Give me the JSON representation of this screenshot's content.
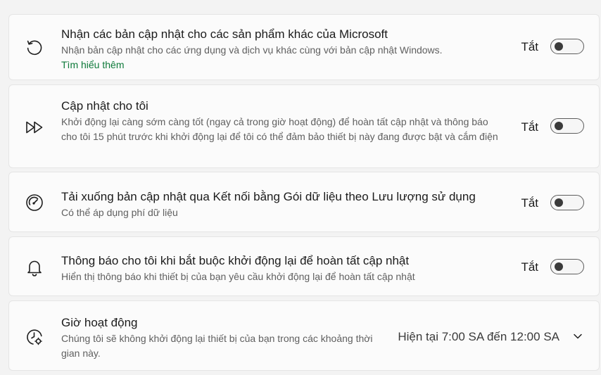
{
  "settings": [
    {
      "title": "Nhận các bản cập nhật cho các sản phẩm khác của Microsoft",
      "description": "Nhận bản cập nhật cho các ứng dụng và dịch vụ khác cùng với bản cập nhật Windows.",
      "link": "Tìm hiểu thêm",
      "state": "Tắt",
      "toggle_on": false,
      "icon": "history-icon"
    },
    {
      "title": "Cập nhật cho tôi",
      "description": "Khởi động lại càng sớm càng tốt (ngay cả trong giờ hoạt động) để hoàn tất cập nhật và thông báo cho tôi 15 phút trước khi khởi động lại để tôi có thể đảm bảo thiết bị này đang được bật và cắm điện",
      "state": "Tắt",
      "toggle_on": false,
      "icon": "fast-forward-icon"
    },
    {
      "title": "Tải xuống bản cập nhật qua Kết nối bằng Gói dữ liệu theo Lưu lượng sử dụng",
      "description": "Có thể áp dụng phí dữ liệu",
      "state": "Tắt",
      "toggle_on": false,
      "icon": "gauge-icon"
    },
    {
      "title": "Thông báo cho tôi khi bắt buộc khởi động lại để hoàn tất cập nhật",
      "description": "Hiển thị thông báo khi thiết bị của bạn yêu cầu khởi động lại để hoàn tất cập nhật",
      "state": "Tắt",
      "toggle_on": false,
      "icon": "bell-icon"
    },
    {
      "title": "Giờ hoạt động",
      "description": "Chúng tôi sẽ không khởi động lại thiết bị của bạn trong các khoảng thời gian này.",
      "value": "Hiện tại 7:00 SA đến 12:00 SA",
      "icon": "clock-settings-icon"
    }
  ],
  "colors": {
    "background": "#f3f3f3",
    "card": "#fbfbfb",
    "link": "#0e7a3a",
    "toggle_knob": "#3a3a3a"
  }
}
